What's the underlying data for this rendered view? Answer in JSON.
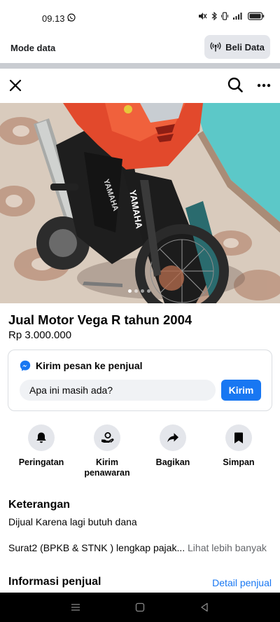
{
  "status_bar": {
    "time": "09.13",
    "battery_icon": "battery-icon"
  },
  "data_bar": {
    "mode_label": "Mode data",
    "buy_label": "Beli Data"
  },
  "listing": {
    "title": "Jual Motor Vega R tahun 2004",
    "price": "Rp 3.000.000",
    "photo_count": 4,
    "photo_active_index": 0
  },
  "message": {
    "heading": "Kirim pesan ke penjual",
    "input_value": "Apa ini masih ada?",
    "send_label": "Kirim"
  },
  "actions": [
    {
      "label": "Peringatan",
      "icon": "bell-icon"
    },
    {
      "label": "Kirim penawaran",
      "icon": "offer-icon"
    },
    {
      "label": "Bagikan",
      "icon": "share-icon"
    },
    {
      "label": "Simpan",
      "icon": "bookmark-icon"
    }
  ],
  "description": {
    "heading": "Keterangan",
    "line1": "Dijual Karena lagi butuh dana",
    "line2": "Surat2 (BPKB & STNK ) lengkap pajak...",
    "see_more": "Lihat lebih banyak"
  },
  "seller": {
    "heading": "Informasi penjual",
    "detail_link": "Detail penjual"
  },
  "colors": {
    "accent": "#1877f2",
    "button_bg": "#e4e6eb",
    "divider": "#c9ccd1"
  }
}
